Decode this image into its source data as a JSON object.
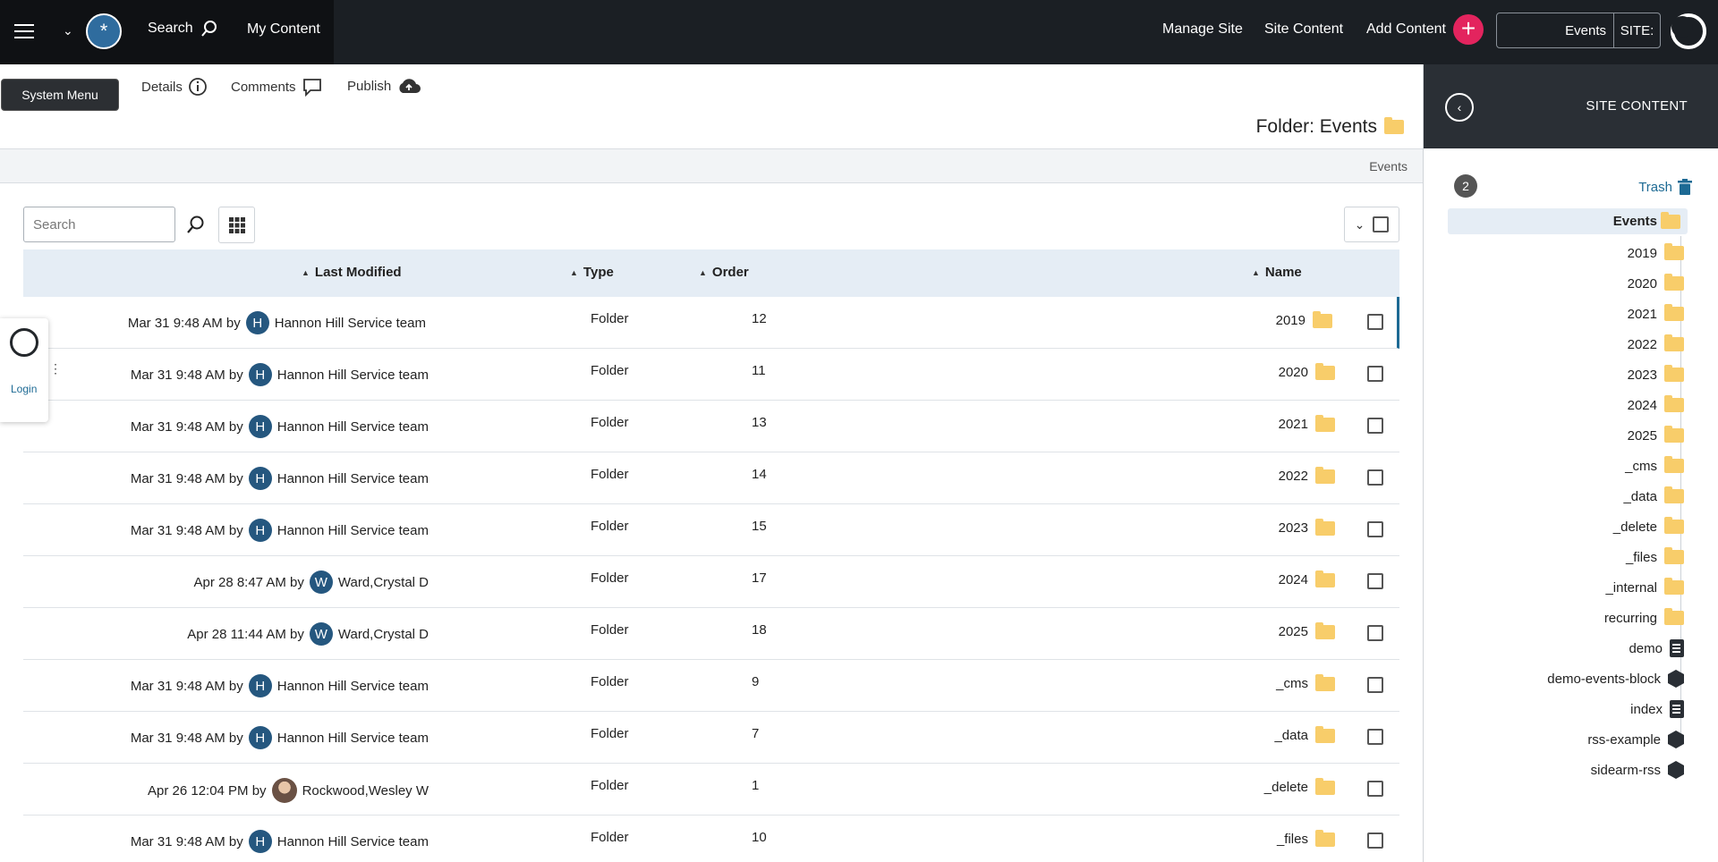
{
  "topbar": {
    "search_label": "Search",
    "my_content": "My Content",
    "avatar_symbol": "*",
    "manage_site": "Manage Site",
    "site_content": "Site Content",
    "add_content": "Add Content",
    "add_symbol": "+",
    "site_label": "SITE:",
    "site_value": "Events"
  },
  "toolbar": {
    "system_menu": "System Menu",
    "details": "Details",
    "comments": "Comments",
    "publish": "Publish"
  },
  "folder": {
    "title": "Folder: Events",
    "breadcrumb": "Events"
  },
  "list": {
    "search_placeholder": "Search",
    "columns": {
      "name": "Name",
      "order": "Order",
      "type": "Type",
      "last_modified": "Last Modified"
    },
    "rows": [
      {
        "name": "2019",
        "order": "12",
        "type": "Folder",
        "modified": "Mar 31 9:48 AM by",
        "user": "Hannon Hill Service team",
        "initial": "H"
      },
      {
        "name": "2020",
        "order": "11",
        "type": "Folder",
        "modified": "Mar 31 9:48 AM by",
        "user": "Hannon Hill Service team",
        "initial": "H"
      },
      {
        "name": "2021",
        "order": "13",
        "type": "Folder",
        "modified": "Mar 31 9:48 AM by",
        "user": "Hannon Hill Service team",
        "initial": "H"
      },
      {
        "name": "2022",
        "order": "14",
        "type": "Folder",
        "modified": "Mar 31 9:48 AM by",
        "user": "Hannon Hill Service team",
        "initial": "H"
      },
      {
        "name": "2023",
        "order": "15",
        "type": "Folder",
        "modified": "Mar 31 9:48 AM by",
        "user": "Hannon Hill Service team",
        "initial": "H"
      },
      {
        "name": "2024",
        "order": "17",
        "type": "Folder",
        "modified": "Apr 28 8:47 AM by",
        "user": "Ward,Crystal D",
        "initial": "W"
      },
      {
        "name": "2025",
        "order": "18",
        "type": "Folder",
        "modified": "Apr 28 11:44 AM by",
        "user": "Ward,Crystal D",
        "initial": "W"
      },
      {
        "name": "_cms",
        "order": "9",
        "type": "Folder",
        "modified": "Mar 31 9:48 AM by",
        "user": "Hannon Hill Service team",
        "initial": "H"
      },
      {
        "name": "_data",
        "order": "7",
        "type": "Folder",
        "modified": "Mar 31 9:48 AM by",
        "user": "Hannon Hill Service team",
        "initial": "H"
      },
      {
        "name": "_delete",
        "order": "1",
        "type": "Folder",
        "modified": "Apr 26 12:04 PM by",
        "user": "Rockwood,Wesley W",
        "initial": ""
      },
      {
        "name": "_files",
        "order": "10",
        "type": "Folder",
        "modified": "Mar 31 9:48 AM by",
        "user": "Hannon Hill Service team",
        "initial": "H"
      }
    ]
  },
  "login_flyout": {
    "label": "Login",
    "dots": "⋮"
  },
  "sidebar": {
    "title": "SITE CONTENT",
    "collapse_symbol": "‹",
    "trash_label": "Trash",
    "trash_count": "2",
    "root": "Events",
    "items": [
      {
        "label": "2019",
        "kind": "folder"
      },
      {
        "label": "2020",
        "kind": "folder"
      },
      {
        "label": "2021",
        "kind": "folder"
      },
      {
        "label": "2022",
        "kind": "folder"
      },
      {
        "label": "2023",
        "kind": "folder"
      },
      {
        "label": "2024",
        "kind": "folder"
      },
      {
        "label": "2025",
        "kind": "folder"
      },
      {
        "label": "_cms",
        "kind": "folder"
      },
      {
        "label": "_data",
        "kind": "folder"
      },
      {
        "label": "_delete",
        "kind": "folder"
      },
      {
        "label": "_files",
        "kind": "folder"
      },
      {
        "label": "_internal",
        "kind": "folder"
      },
      {
        "label": "recurring",
        "kind": "folder"
      },
      {
        "label": "demo",
        "kind": "page"
      },
      {
        "label": "demo-events-block",
        "kind": "block"
      },
      {
        "label": "index",
        "kind": "page"
      },
      {
        "label": "rss-example",
        "kind": "block"
      },
      {
        "label": "sidearm-rss",
        "kind": "block"
      }
    ]
  },
  "colors": {
    "topbar": "#1b1f24",
    "accent_pink": "#e3245e",
    "avatar_blue": "#25577f",
    "folder_yellow": "#f8cd6a",
    "link_blue": "#1d6a94"
  }
}
